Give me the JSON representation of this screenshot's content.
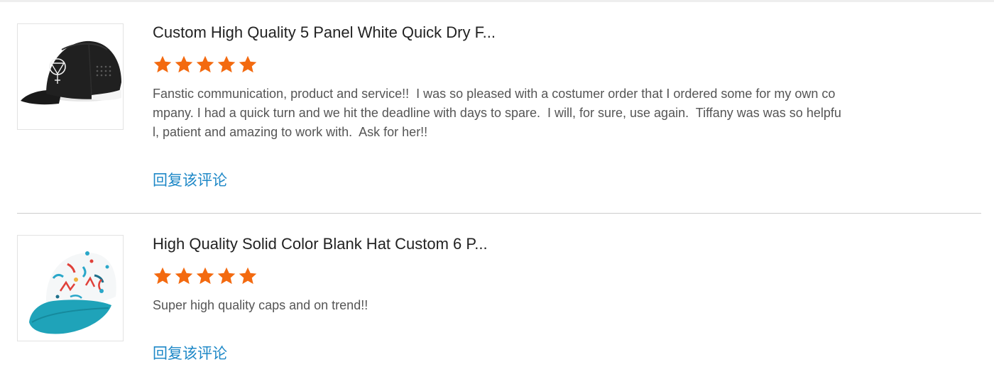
{
  "colors": {
    "star": "#f36a10",
    "reply_link": "#1e88c7",
    "divider": "#cccccc"
  },
  "reviews": [
    {
      "product_title": "Custom High Quality 5 Panel White Quick Dry F...",
      "rating": 5,
      "rating_max": 5,
      "text": "Fanstic communication, product and service!!  I was so pleased with a costumer order that I ordered some for my own company. I had a quick turn and we hit the deadline with days to spare.  I will, for sure, use again.  Tiffany was was so helpful, patient and amazing to work with.  Ask for her!!",
      "reply_label": "回复该评论",
      "thumbnail_icon": "black-cap-image"
    },
    {
      "product_title": "High Quality Solid Color Blank Hat Custom 6 P...",
      "rating": 5,
      "rating_max": 5,
      "text": "Super high quality caps and on trend!!",
      "reply_label": "回复该评论",
      "thumbnail_icon": "printed-cap-image"
    }
  ]
}
